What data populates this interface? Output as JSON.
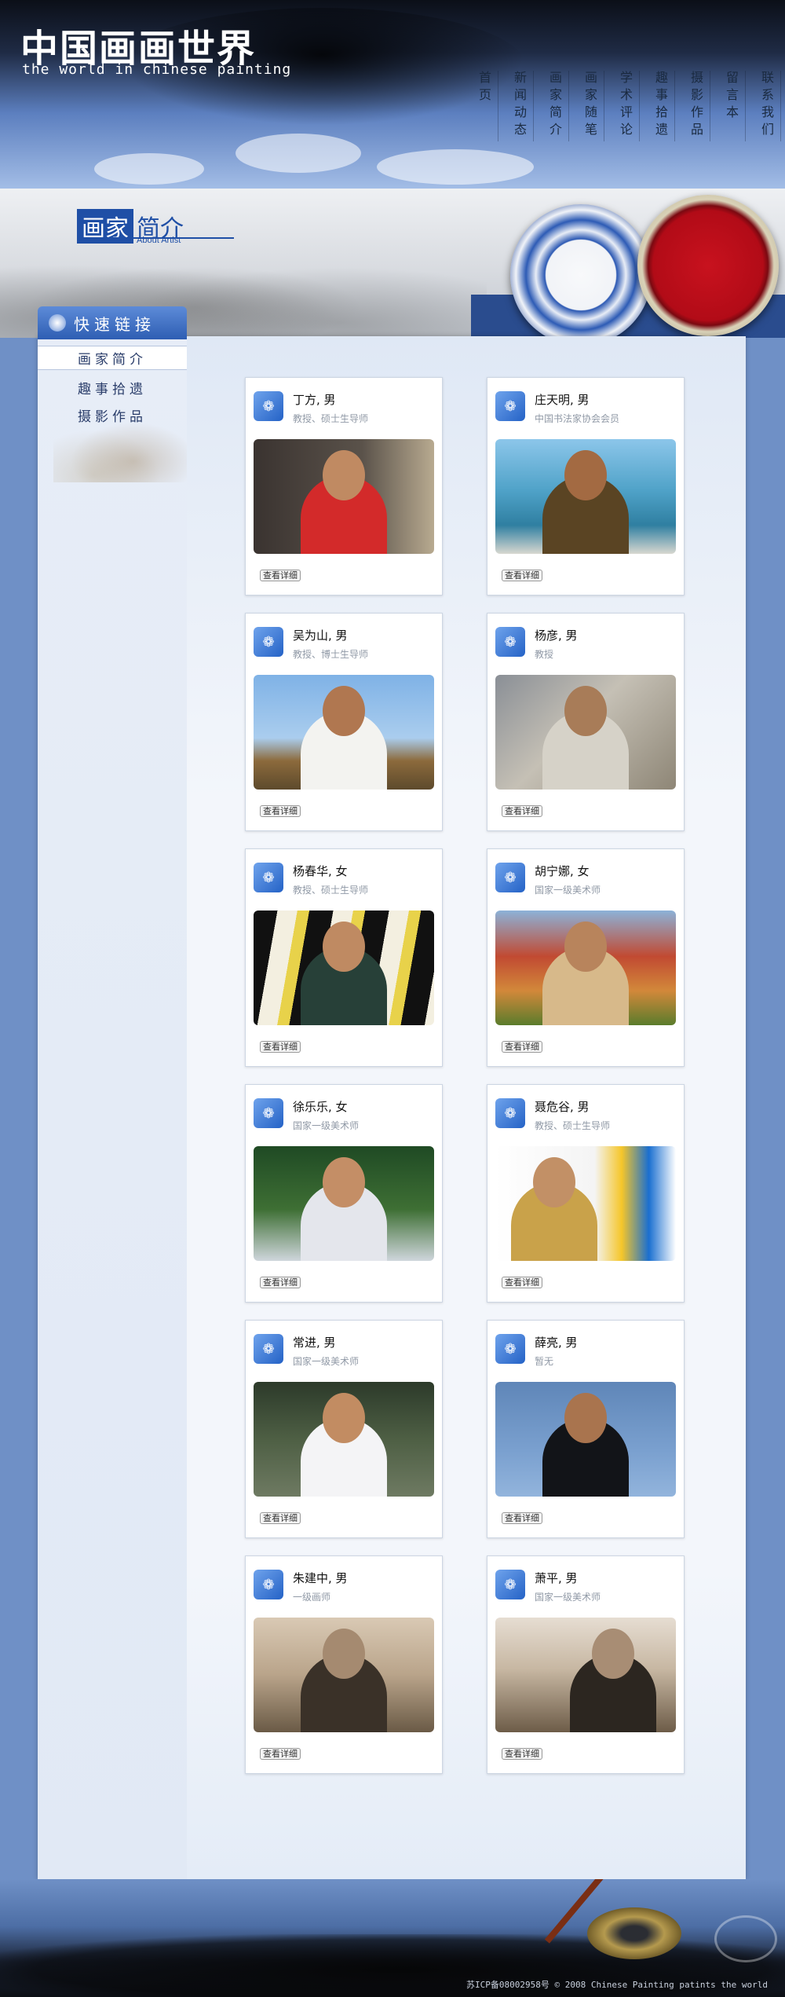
{
  "header": {
    "logo_cn": "中国画画世界",
    "logo_en": "the world in chinese painting",
    "nav": [
      "首页",
      "新闻动态",
      "画家简介",
      "画家随笔",
      "学术评论",
      "趣事拾遗",
      "摄影作品",
      "留言本",
      "联系我们"
    ]
  },
  "banner": {
    "title_a": "画家",
    "title_b": "简介",
    "subtitle": "About Artist"
  },
  "sidebar": {
    "title": "快速链接",
    "links": [
      "画家简介",
      "趣事拾遗",
      "摄影作品"
    ]
  },
  "cards": [
    {
      "name": "丁方, 男",
      "title": "教授、硕士生导师",
      "button": "查看详细"
    },
    {
      "name": "庄天明, 男",
      "title": "中国书法家协会会员",
      "button": "查看详细"
    },
    {
      "name": "吴为山, 男",
      "title": "教授、博士生导师",
      "button": "查看详细"
    },
    {
      "name": "杨彦, 男",
      "title": "教授",
      "button": "查看详细"
    },
    {
      "name": "杨春华, 女",
      "title": "教授、硕士生导师",
      "button": "查看详细"
    },
    {
      "name": "胡宁娜, 女",
      "title": "国家一级美术师",
      "button": "查看详细"
    },
    {
      "name": "徐乐乐, 女",
      "title": "国家一级美术师",
      "button": "查看详细"
    },
    {
      "name": "聂危谷, 男",
      "title": "教授、硕士生导师",
      "button": "查看详细"
    },
    {
      "name": "常进, 男",
      "title": "国家一级美术师",
      "button": "查看详细"
    },
    {
      "name": "薛亮, 男",
      "title": "暂无",
      "button": "查看详细"
    },
    {
      "name": "朱建中, 男",
      "title": "一级画师",
      "button": "查看详细"
    },
    {
      "name": "萧平, 男",
      "title": "国家一级美术师",
      "button": "查看详细"
    }
  ],
  "footer": {
    "text": "苏ICP备08002958号  © 2008  Chinese Painting patints the world"
  }
}
